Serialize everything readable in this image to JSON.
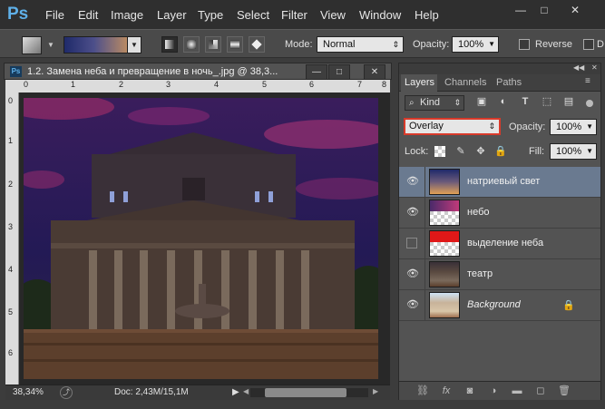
{
  "app": {
    "logo": "Ps"
  },
  "menu": [
    "File",
    "Edit",
    "Image",
    "Layer",
    "Type",
    "Select",
    "Filter",
    "View",
    "Window",
    "Help"
  ],
  "window_controls": {
    "minimize": "—",
    "restore": "□",
    "close": "✕"
  },
  "options_bar": {
    "mode_label": "Mode:",
    "mode_value": "Normal",
    "opacity_label": "Opacity:",
    "opacity_value": "100%",
    "reverse_label": "Reverse",
    "dither_label": "D"
  },
  "document": {
    "icon_label": "Ps",
    "title": "1.2. Замена неба и превращение в ночь_.jpg @ 38,3...",
    "buttons": {
      "minimize": "—",
      "restore": "□",
      "close": "✕"
    },
    "ruler_top": [
      "0",
      "1",
      "2",
      "3",
      "4",
      "5",
      "6",
      "7",
      "8"
    ],
    "ruler_left": [
      "0",
      "1",
      "2",
      "3",
      "4",
      "5",
      "6"
    ],
    "zoom": "38,34%",
    "doc_info": "Doc: 2,43M/15,1M"
  },
  "panel": {
    "tabs": [
      "Layers",
      "Channels",
      "Paths"
    ],
    "active_tab": "Layers",
    "filter_kind": "Kind",
    "blend_mode": "Overlay",
    "opacity_label": "Opacity:",
    "opacity_value": "100%",
    "lock_label": "Lock:",
    "fill_label": "Fill:",
    "fill_value": "100%",
    "layers": [
      {
        "name": "натриевый свет",
        "visible": true,
        "selected": true,
        "thumb": "gradient"
      },
      {
        "name": "небо",
        "visible": true,
        "selected": false,
        "thumb": "checker-sky"
      },
      {
        "name": "выделение неба",
        "visible": false,
        "selected": false,
        "thumb": "red-mask"
      },
      {
        "name": "театр",
        "visible": true,
        "selected": false,
        "thumb": "theatre"
      },
      {
        "name": "Background",
        "visible": true,
        "selected": false,
        "thumb": "photo",
        "locked": true
      }
    ]
  },
  "colors": {
    "selection": "#6a7a90",
    "highlight_border": "#d83a2a",
    "ps_blue": "#5fb0e8"
  }
}
